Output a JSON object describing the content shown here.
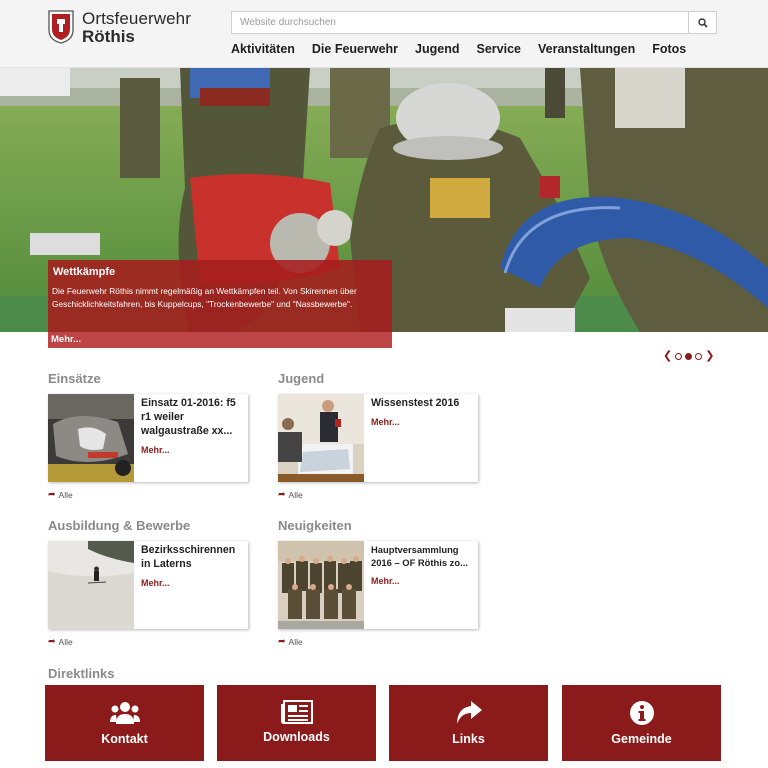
{
  "header": {
    "logo_line1": "Ortsfeuerwehr",
    "logo_line2": "Röthis",
    "search_placeholder": "Website durchsuchen",
    "nav": [
      "Aktivitäten",
      "Die Feuerwehr",
      "Jugend",
      "Service",
      "Veranstaltungen",
      "Fotos"
    ]
  },
  "slider": {
    "title": "Wettkämpfe",
    "text": "Die Feuerwehr Röthis nimmt regelmäßig an Wettkämpfen teil. Von Skirennen über Geschicklichkeitsfahren, bis Kuppelcups, \"Trockenbewerbe\" und \"Nassbewerbe\".",
    "more": "Mehr...",
    "active_slide": 2,
    "slide_count": 3
  },
  "sections": [
    {
      "title": "Einsätze",
      "card_title": "Einsatz 01-2016: f5 r1 weiler walgaustraße xx...",
      "more": "Mehr...",
      "all": "Alle"
    },
    {
      "title": "Jugend",
      "card_title": "Wissenstest 2016",
      "more": "Mehr...",
      "all": "Alle"
    },
    {
      "title": "Ausbildung & Bewerbe",
      "card_title": "Bezirksschirennen in Laterns",
      "more": "Mehr...",
      "all": "Alle"
    },
    {
      "title": "Neuigkeiten",
      "card_title": "Hauptversammlung 2016 – OF Röthis zo...",
      "more": "Mehr...",
      "all": "Alle"
    }
  ],
  "direktlinks": {
    "title": "Direktlinks",
    "tiles": [
      {
        "label": "Kontakt",
        "icon": "users-icon"
      },
      {
        "label": "Downloads",
        "icon": "newspaper-icon"
      },
      {
        "label": "Links",
        "icon": "share-arrow-icon"
      },
      {
        "label": "Gemeinde",
        "icon": "info-icon"
      }
    ]
  },
  "colors": {
    "brand": "#8b1a1a",
    "caption_bg": "#a51e1e"
  }
}
